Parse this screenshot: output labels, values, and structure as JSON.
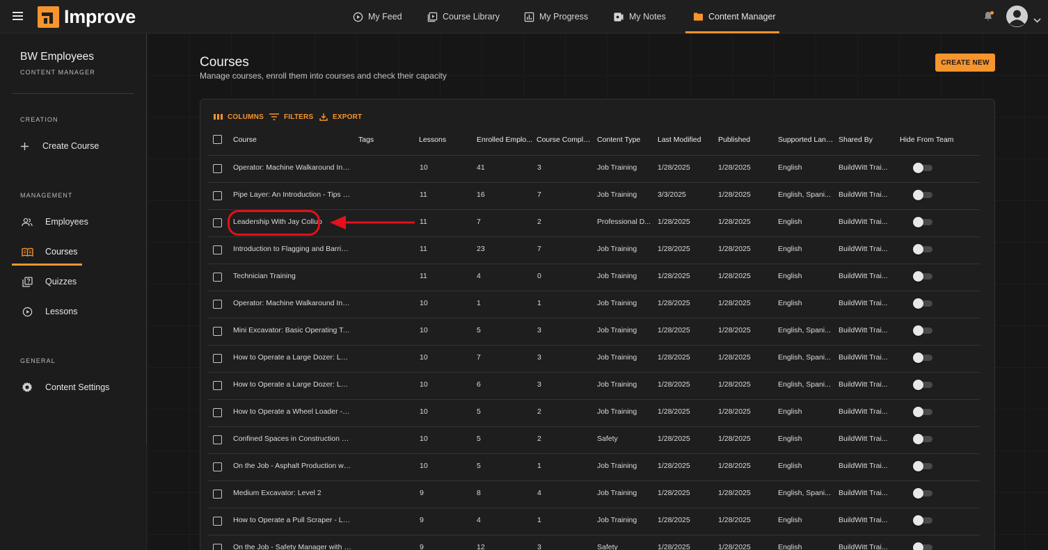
{
  "brand": {
    "name": "Improve",
    "accent": "#f7942e"
  },
  "nav": [
    {
      "label": "My Feed",
      "icon": "play-circle-icon"
    },
    {
      "label": "Course Library",
      "icon": "library-icon"
    },
    {
      "label": "My Progress",
      "icon": "bar-chart-icon"
    },
    {
      "label": "My Notes",
      "icon": "notes-icon"
    },
    {
      "label": "Content Manager",
      "icon": "folder-icon",
      "active": true
    }
  ],
  "sidebar": {
    "org_name": "BW Employees",
    "org_sub": "CONTENT MANAGER",
    "sections": {
      "creation": "CREATION",
      "management": "MANAGEMENT",
      "general": "GENERAL"
    },
    "items": {
      "create_course": "Create Course",
      "employees": "Employees",
      "courses": "Courses",
      "quizzes": "Quizzes",
      "lessons": "Lessons",
      "content_settings": "Content Settings"
    }
  },
  "page": {
    "title": "Courses",
    "subtitle": "Manage courses, enroll them into courses and check their capacity",
    "create_button": "CREATE NEW"
  },
  "toolbar": {
    "columns": "COLUMNS",
    "filters": "FILTERS",
    "export": "EXPORT"
  },
  "table": {
    "headers": {
      "course": "Course",
      "tags": "Tags",
      "lessons": "Lessons",
      "enrolled": "Enrolled Emplo...",
      "completed": "Course Complet...",
      "content_type": "Content Type",
      "last_modified": "Last Modified",
      "published": "Published",
      "languages": "Supported Lang...",
      "shared_by": "Shared By",
      "hide": "Hide From Team"
    },
    "rows": [
      {
        "course": "Operator: Machine Walkaround Ins...",
        "tags": "",
        "lessons": "10",
        "enrolled": "41",
        "completed": "3",
        "content_type": "Job Training",
        "last_modified": "1/28/2025",
        "published": "1/28/2025",
        "languages": "English",
        "shared_by": "BuildWitt Trai...",
        "hidden": false
      },
      {
        "course": "Pipe Layer: An Introduction - Tips a...",
        "tags": "",
        "lessons": "11",
        "enrolled": "16",
        "completed": "7",
        "content_type": "Job Training",
        "last_modified": "3/3/2025",
        "published": "1/28/2025",
        "languages": "English, Spani...",
        "shared_by": "BuildWitt Trai...",
        "hidden": false
      },
      {
        "course": "Leadership With Jay Collup",
        "tags": "",
        "lessons": "11",
        "enrolled": "7",
        "completed": "2",
        "content_type": "Professional D...",
        "last_modified": "1/28/2025",
        "published": "1/28/2025",
        "languages": "English",
        "shared_by": "BuildWitt Trai...",
        "hidden": false
      },
      {
        "course": "Introduction to Flagging and Barrica...",
        "tags": "",
        "lessons": "11",
        "enrolled": "23",
        "completed": "7",
        "content_type": "Job Training",
        "last_modified": "1/28/2025",
        "published": "1/28/2025",
        "languages": "English",
        "shared_by": "BuildWitt Trai...",
        "hidden": false
      },
      {
        "course": "Technician Training",
        "tags": "",
        "lessons": "11",
        "enrolled": "4",
        "completed": "0",
        "content_type": "Job Training",
        "last_modified": "1/28/2025",
        "published": "1/28/2025",
        "languages": "English",
        "shared_by": "BuildWitt Trai...",
        "hidden": false
      },
      {
        "course": "Operator: Machine Walkaround Ins...",
        "tags": "",
        "lessons": "10",
        "enrolled": "1",
        "completed": "1",
        "content_type": "Job Training",
        "last_modified": "1/28/2025",
        "published": "1/28/2025",
        "languages": "English",
        "shared_by": "BuildWitt Trai...",
        "hidden": false
      },
      {
        "course": "Mini Excavator: Basic Operating Tec...",
        "tags": "",
        "lessons": "10",
        "enrolled": "5",
        "completed": "3",
        "content_type": "Job Training",
        "last_modified": "1/28/2025",
        "published": "1/28/2025",
        "languages": "English, Spani...",
        "shared_by": "BuildWitt Trai...",
        "hidden": false
      },
      {
        "course": "How to Operate a Large Dozer: Lev...",
        "tags": "",
        "lessons": "10",
        "enrolled": "7",
        "completed": "3",
        "content_type": "Job Training",
        "last_modified": "1/28/2025",
        "published": "1/28/2025",
        "languages": "English, Spani...",
        "shared_by": "BuildWitt Trai...",
        "hidden": false
      },
      {
        "course": "How to Operate a Large Dozer: Lev...",
        "tags": "",
        "lessons": "10",
        "enrolled": "6",
        "completed": "3",
        "content_type": "Job Training",
        "last_modified": "1/28/2025",
        "published": "1/28/2025",
        "languages": "English, Spani...",
        "shared_by": "BuildWitt Trai...",
        "hidden": false
      },
      {
        "course": "How to Operate a Wheel Loader - L...",
        "tags": "",
        "lessons": "10",
        "enrolled": "5",
        "completed": "2",
        "content_type": "Job Training",
        "last_modified": "1/28/2025",
        "published": "1/28/2025",
        "languages": "English",
        "shared_by": "BuildWitt Trai...",
        "hidden": false
      },
      {
        "course": "Confined Spaces in Construction Le...",
        "tags": "",
        "lessons": "10",
        "enrolled": "5",
        "completed": "2",
        "content_type": "Safety",
        "last_modified": "1/28/2025",
        "published": "1/28/2025",
        "languages": "English",
        "shared_by": "BuildWitt Trai...",
        "hidden": false
      },
      {
        "course": "On the Job - Asphalt Production wit...",
        "tags": "",
        "lessons": "10",
        "enrolled": "5",
        "completed": "1",
        "content_type": "Job Training",
        "last_modified": "1/28/2025",
        "published": "1/28/2025",
        "languages": "English",
        "shared_by": "BuildWitt Trai...",
        "hidden": false
      },
      {
        "course": "Medium Excavator: Level 2",
        "tags": "",
        "lessons": "9",
        "enrolled": "8",
        "completed": "4",
        "content_type": "Job Training",
        "last_modified": "1/28/2025",
        "published": "1/28/2025",
        "languages": "English, Spani...",
        "shared_by": "BuildWitt Trai...",
        "hidden": false
      },
      {
        "course": "How to Operate a Pull Scraper - Lev...",
        "tags": "",
        "lessons": "9",
        "enrolled": "4",
        "completed": "1",
        "content_type": "Job Training",
        "last_modified": "1/28/2025",
        "published": "1/28/2025",
        "languages": "English",
        "shared_by": "BuildWitt Trai...",
        "hidden": false
      },
      {
        "course": "On the Job - Safety Manager with S...",
        "tags": "",
        "lessons": "9",
        "enrolled": "12",
        "completed": "3",
        "content_type": "Safety",
        "last_modified": "1/28/2025",
        "published": "1/28/2025",
        "languages": "English",
        "shared_by": "BuildWitt Trai...",
        "hidden": false
      }
    ]
  },
  "annotation": {
    "highlighted_row_index": 2,
    "color": "#e4101b"
  }
}
